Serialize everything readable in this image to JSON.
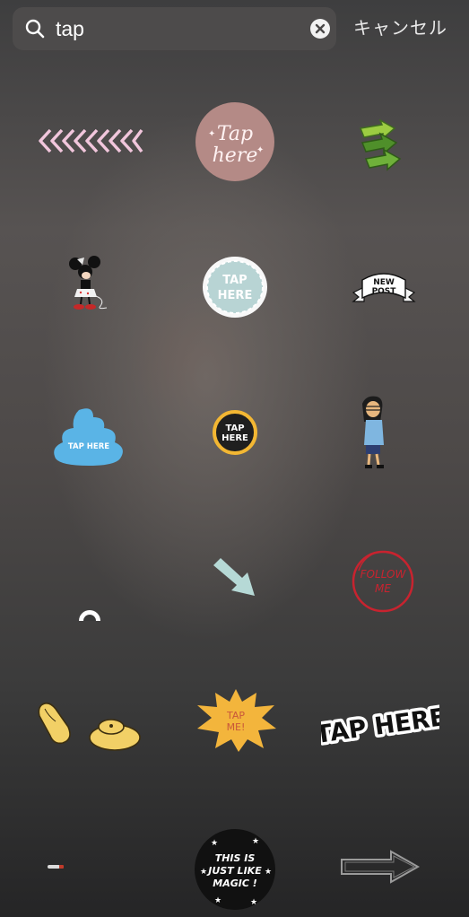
{
  "search": {
    "query": "tap",
    "clear_icon": "clear-circle-x-icon",
    "search_icon": "magnifier-icon"
  },
  "cancel_label": "キャンセル",
  "stickers": {
    "tap_here_script_1": "Tap",
    "tap_here_script_2": "here",
    "tap_here_circle_1": "TAP",
    "tap_here_circle_2": "HERE",
    "new_post_1": "NEW",
    "new_post_2": "POST",
    "poop_label": "TAP HERE",
    "tap_here_ring_1": "TAP",
    "tap_here_ring_2": "HERE",
    "follow_me_1": "FOLLOW",
    "follow_me_2": "ME",
    "tap_me_1": "TAP",
    "tap_me_2": "ME!",
    "tap_here_bold": "TAP HERE",
    "magic_1": "THIS IS",
    "magic_2": "JUST LIKE",
    "magic_3": "MAGIC !"
  }
}
